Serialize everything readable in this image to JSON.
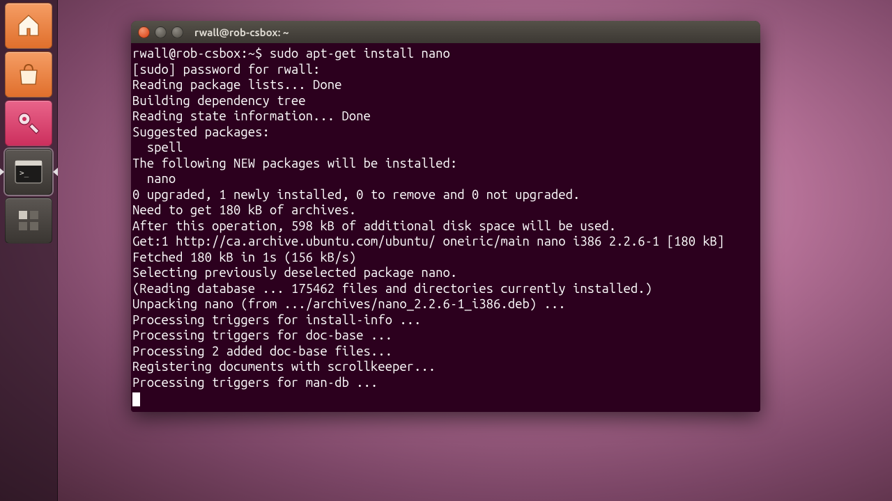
{
  "launcher": {
    "items": [
      {
        "name": "home-folder",
        "icon": "home"
      },
      {
        "name": "software-center",
        "icon": "bag"
      },
      {
        "name": "system-settings",
        "icon": "gear"
      },
      {
        "name": "terminal",
        "icon": "terminal",
        "active": true
      },
      {
        "name": "workspace-switcher",
        "icon": "workspaces"
      }
    ]
  },
  "window": {
    "title": "rwall@rob-csbox: ~",
    "close": "close",
    "minimize": "minimize",
    "maximize": "maximize"
  },
  "terminal": {
    "prompt": "rwall@rob-csbox:~$ ",
    "command": "sudo apt-get install nano",
    "lines": [
      "[sudo] password for rwall: ",
      "Reading package lists... Done",
      "Building dependency tree       ",
      "Reading state information... Done",
      "Suggested packages:",
      "  spell",
      "The following NEW packages will be installed:",
      "  nano",
      "0 upgraded, 1 newly installed, 0 to remove and 0 not upgraded.",
      "Need to get 180 kB of archives.",
      "After this operation, 598 kB of additional disk space will be used.",
      "Get:1 http://ca.archive.ubuntu.com/ubuntu/ oneiric/main nano i386 2.2.6-1 [180 kB]",
      "Fetched 180 kB in 1s (156 kB/s)",
      "Selecting previously deselected package nano.",
      "(Reading database ... 175462 files and directories currently installed.)",
      "Unpacking nano (from .../archives/nano_2.2.6-1_i386.deb) ...",
      "Processing triggers for install-info ...",
      "Processing triggers for doc-base ...",
      "Processing 2 added doc-base files...",
      "Registering documents with scrollkeeper...",
      "Processing triggers for man-db ..."
    ]
  }
}
